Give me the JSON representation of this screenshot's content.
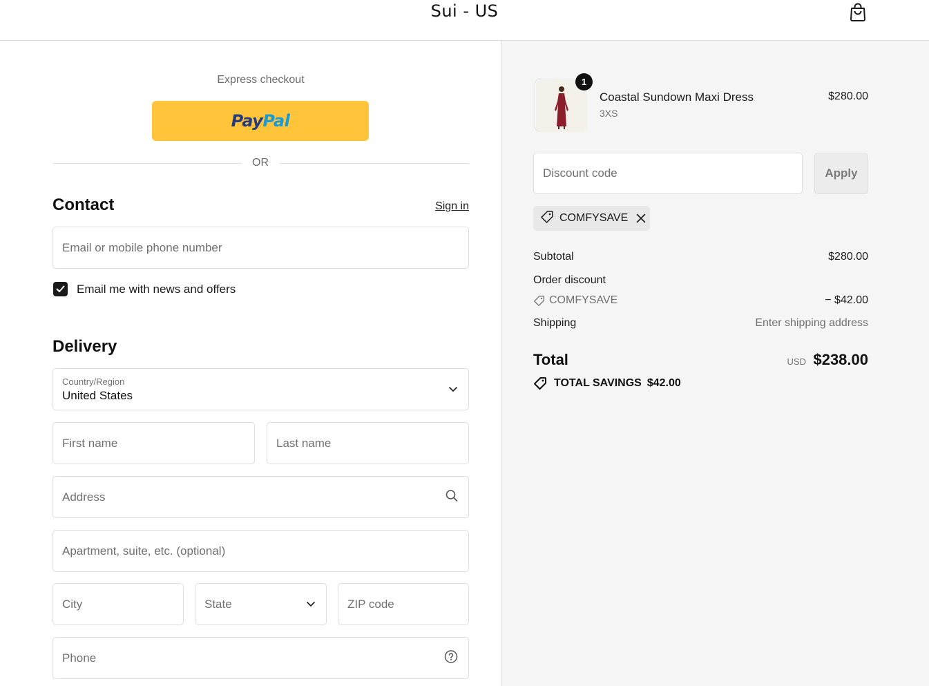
{
  "header": {
    "store_name": "Sui - US",
    "cart_icon": "shopping-bag-icon"
  },
  "checkout": {
    "express_title": "Express checkout",
    "paypal": {
      "pay": "Pay",
      "pal": "Pal",
      "button_color": "#ffc439"
    },
    "or_text": "OR",
    "contact": {
      "title": "Contact",
      "sign_in": "Sign in",
      "email_placeholder": "Email or mobile phone number",
      "newsletter_label": "Email me with news and offers",
      "newsletter_checked": true
    },
    "delivery": {
      "title": "Delivery",
      "country_label": "Country/Region",
      "country_value": "United States",
      "first_name_placeholder": "First name",
      "last_name_placeholder": "Last name",
      "address_placeholder": "Address",
      "apartment_placeholder": "Apartment, suite, etc. (optional)",
      "city_placeholder": "City",
      "state_placeholder": "State",
      "zip_placeholder": "ZIP code",
      "phone_placeholder": "Phone"
    }
  },
  "summary": {
    "item": {
      "quantity": "1",
      "name": "Coastal Sundown Maxi Dress",
      "variant": "3XS",
      "price": "$280.00"
    },
    "discount_placeholder": "Discount code",
    "apply_label": "Apply",
    "applied_code": "COMFYSAVE",
    "subtotal_label": "Subtotal",
    "subtotal_value": "$280.00",
    "order_discount_label": "Order discount",
    "order_discount_code": "COMFYSAVE",
    "order_discount_value": "− $42.00",
    "shipping_label": "Shipping",
    "shipping_value": "Enter shipping address",
    "total_label": "Total",
    "total_currency": "USD",
    "total_value": "$238.00",
    "savings_label": "TOTAL SAVINGS",
    "savings_value": "$42.00"
  }
}
